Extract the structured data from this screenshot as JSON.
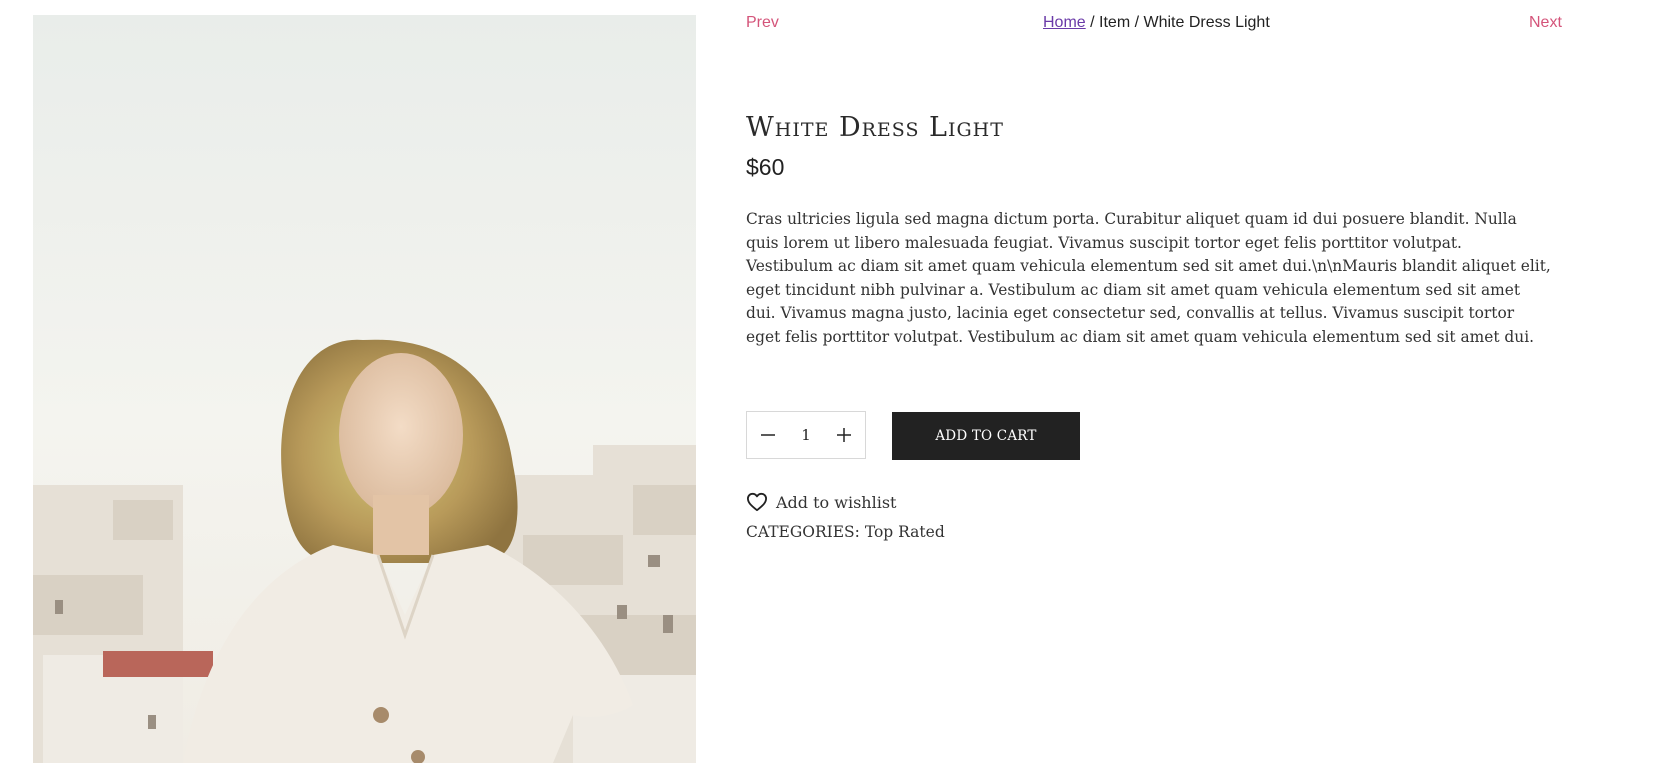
{
  "nav": {
    "prev_label": "Prev",
    "next_label": "Next"
  },
  "breadcrumb": {
    "home": "Home",
    "separator": " / ",
    "item": "Item",
    "current": "White Dress Light"
  },
  "product": {
    "title": "White Dress Light",
    "price": "$60",
    "description": "Cras ultricies ligula sed magna dictum porta. Curabitur aliquet quam id dui posuere blandit. Nulla quis lorem ut libero malesuada feugiat. Vivamus suscipit tortor eget felis porttitor volutpat. Vestibulum ac diam sit amet quam vehicula elementum sed sit amet dui.\\n\\nMauris blandit aliquet elit, eget tincidunt nibh pulvinar a. Vestibulum ac diam sit amet quam vehicula elementum sed sit amet dui. Vivamus magna justo, lacinia eget consectetur sed, convallis at tellus. Vivamus suscipit tortor eget felis porttitor volutpat. Vestibulum ac diam sit amet quam vehicula elementum sed sit amet dui.",
    "quantity": "1",
    "add_to_cart_label": "ADD TO CART",
    "wishlist_label": "Add to wishlist",
    "categories_label": "CATEGORIES:",
    "category": "Top Rated"
  },
  "icons": {
    "minus": "minus-icon",
    "plus": "plus-icon",
    "heart": "heart-icon"
  },
  "colors": {
    "nav_link": "#d4547a",
    "home_link": "#6a3aa8",
    "button_bg": "#222222",
    "button_text": "#ffffff"
  }
}
